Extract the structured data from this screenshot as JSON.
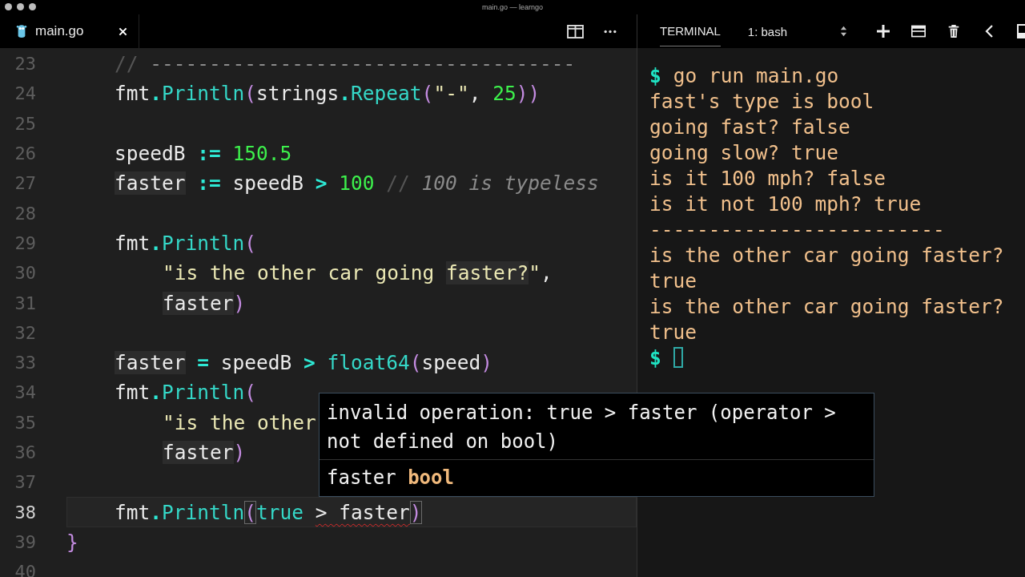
{
  "window": {
    "title": "main.go — learngo"
  },
  "editor": {
    "tab": {
      "label": "main.go"
    },
    "lines": [
      {
        "number": "23",
        "current": false,
        "kind": "statement",
        "tokens": [
          {
            "kind": "comment-mark",
            "text": "//"
          },
          {
            "kind": "comment-rule",
            "text": " ------------------------------------"
          }
        ]
      },
      {
        "number": "24",
        "current": false,
        "kind": "statement",
        "tokens": [
          {
            "kind": "plain",
            "text": "fmt"
          },
          {
            "kind": "op",
            "text": "."
          },
          {
            "kind": "fn",
            "text": "Println"
          },
          {
            "kind": "paren",
            "text": "("
          },
          {
            "kind": "plain",
            "text": "strings"
          },
          {
            "kind": "op",
            "text": "."
          },
          {
            "kind": "fn",
            "text": "Repeat"
          },
          {
            "kind": "paren",
            "text": "("
          },
          {
            "kind": "str",
            "text": "\"-\""
          },
          {
            "kind": "plain",
            "text": ", "
          },
          {
            "kind": "num",
            "text": "25"
          },
          {
            "kind": "paren",
            "text": "))"
          }
        ]
      },
      {
        "number": "25",
        "current": false,
        "kind": "blank"
      },
      {
        "number": "26",
        "current": false,
        "kind": "statement",
        "tokens": [
          {
            "kind": "plain",
            "text": "speedB "
          },
          {
            "kind": "op",
            "text": ":="
          },
          {
            "kind": "num",
            "text": " 150.5"
          }
        ]
      },
      {
        "number": "27",
        "current": false,
        "kind": "statement",
        "tokens": [
          {
            "kind": "word-hl",
            "text": "faster"
          },
          {
            "kind": "op",
            "text": " :="
          },
          {
            "kind": "plain",
            "text": " speedB "
          },
          {
            "kind": "op",
            "text": ">"
          },
          {
            "kind": "num",
            "text": " 100"
          },
          {
            "kind": "comment-mark",
            "text": " //"
          },
          {
            "kind": "comment",
            "text": " 100 is typeless"
          }
        ]
      },
      {
        "number": "28",
        "current": false,
        "kind": "blank"
      },
      {
        "number": "29",
        "current": false,
        "kind": "statement",
        "tokens": [
          {
            "kind": "plain",
            "text": "fmt"
          },
          {
            "kind": "op",
            "text": "."
          },
          {
            "kind": "fn",
            "text": "Println"
          },
          {
            "kind": "paren",
            "text": "("
          }
        ]
      },
      {
        "number": "30",
        "current": false,
        "kind": "continuation",
        "tokens": [
          {
            "kind": "str",
            "text": "\"is the other car going "
          },
          {
            "kind": "str-hl",
            "text": "faster?"
          },
          {
            "kind": "str",
            "text": "\""
          },
          {
            "kind": "plain",
            "text": ","
          }
        ]
      },
      {
        "number": "31",
        "current": false,
        "kind": "continuation",
        "tokens": [
          {
            "kind": "word-hl",
            "text": "faster"
          },
          {
            "kind": "paren",
            "text": ")"
          }
        ]
      },
      {
        "number": "32",
        "current": false,
        "kind": "blank"
      },
      {
        "number": "33",
        "current": false,
        "kind": "statement",
        "tokens": [
          {
            "kind": "word-hl",
            "text": "faster"
          },
          {
            "kind": "op",
            "text": " ="
          },
          {
            "kind": "plain",
            "text": " speedB "
          },
          {
            "kind": "op",
            "text": ">"
          },
          {
            "kind": "fn",
            "text": " float64"
          },
          {
            "kind": "paren",
            "text": "("
          },
          {
            "kind": "plain",
            "text": "speed"
          },
          {
            "kind": "paren",
            "text": ")"
          }
        ]
      },
      {
        "number": "34",
        "current": false,
        "kind": "statement",
        "tokens": [
          {
            "kind": "plain",
            "text": "fmt"
          },
          {
            "kind": "op",
            "text": "."
          },
          {
            "kind": "fn",
            "text": "Println"
          },
          {
            "kind": "paren",
            "text": "("
          }
        ]
      },
      {
        "number": "35",
        "current": false,
        "kind": "continuation",
        "tokens": [
          {
            "kind": "str",
            "text": "\"is the other"
          }
        ]
      },
      {
        "number": "36",
        "current": false,
        "kind": "continuation",
        "tokens": [
          {
            "kind": "word-hl",
            "text": "faster"
          },
          {
            "kind": "paren",
            "text": ")"
          }
        ]
      },
      {
        "number": "37",
        "current": false,
        "kind": "blank"
      },
      {
        "number": "38",
        "current": true,
        "kind": "statement",
        "tokens": [
          {
            "kind": "plain",
            "text": "fmt"
          },
          {
            "kind": "op",
            "text": "."
          },
          {
            "kind": "fn",
            "text": "Println"
          },
          {
            "kind": "bracket-match",
            "text": "("
          },
          {
            "kind": "fn",
            "text": "true "
          },
          {
            "kind": "error",
            "text": "> faster"
          },
          {
            "kind": "bracket-match",
            "text": ")"
          }
        ]
      },
      {
        "number": "39",
        "current": false,
        "kind": "block-end",
        "tokens": [
          {
            "kind": "paren",
            "text": "}"
          }
        ]
      },
      {
        "number": "40",
        "current": false,
        "kind": "blank"
      }
    ],
    "hover": {
      "message": "invalid operation: true > faster (operator > not defined on bool)",
      "signature": "faster **bool**"
    }
  },
  "terminal": {
    "tabs": [
      {
        "label": "TERMINAL",
        "selected": true
      }
    ],
    "session": "1: bash",
    "lines": [
      {
        "kind": "command",
        "prompt": "$",
        "text": "go run main.go"
      },
      {
        "kind": "output",
        "text": "fast's type is bool"
      },
      {
        "kind": "output",
        "text": "going fast? false"
      },
      {
        "kind": "output",
        "text": "going slow? true"
      },
      {
        "kind": "output",
        "text": "is it 100 mph? false"
      },
      {
        "kind": "output",
        "text": "is it not 100 mph? true"
      },
      {
        "kind": "output",
        "text": "-------------------------"
      },
      {
        "kind": "output",
        "text": "is the other car going faster?"
      },
      {
        "kind": "output",
        "text": "true"
      },
      {
        "kind": "output",
        "text": "is the other car going faster?"
      },
      {
        "kind": "output",
        "text": "true"
      },
      {
        "kind": "cursor",
        "prompt": "$"
      }
    ]
  }
}
